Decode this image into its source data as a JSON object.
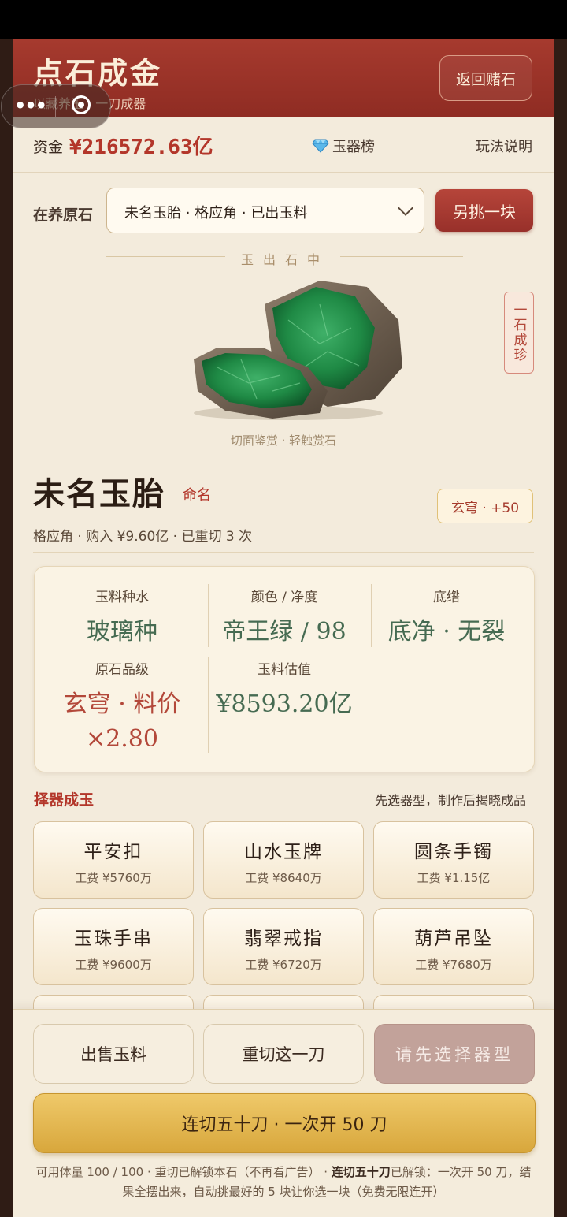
{
  "header": {
    "title": "点石成金",
    "subtitle": "以藏养玉 · 一刀成器",
    "back_label": "返回赌石"
  },
  "fund": {
    "label": "资金",
    "value": "¥216572.63亿",
    "rank_label": "玉器榜",
    "rank_icon": "diamond-icon",
    "rules_label": "玩法说明"
  },
  "stone_select": {
    "label": "在养原石",
    "selected": "未名玉胎 · 格应角 · 已出玉料",
    "pick_label": "另挑一块"
  },
  "viewer": {
    "section_title": "玉出石中",
    "side_tag": "一石成珍",
    "caption": "切面鉴赏 · 轻触赏石"
  },
  "stone": {
    "name": "未名玉胎",
    "rename_label": "命名",
    "grade_badge": "玄穹 · +50",
    "meta": "格应角 · 购入 ¥9.60亿 · 已重切 3 次"
  },
  "attributes": [
    {
      "label": "玉料种水",
      "value": "玻璃种"
    },
    {
      "label": "颜色 / 净度",
      "value": "帝王绿 / 98"
    },
    {
      "label": "底绺",
      "value": "底净 · 无裂"
    },
    {
      "label": "原石品级",
      "value": "玄穹 · 料价 ×2.80"
    },
    {
      "label": "玉料估值",
      "value": "¥8593.20亿"
    }
  ],
  "craft": {
    "title": "择器成玉",
    "hint": "先选器型，制作后揭晓成品",
    "items": [
      {
        "name": "平安扣",
        "fee": "工费 ¥5760万"
      },
      {
        "name": "山水玉牌",
        "fee": "工费 ¥8640万"
      },
      {
        "name": "圆条手镯",
        "fee": "工费 ¥1.15亿"
      },
      {
        "name": "玉珠手串",
        "fee": "工费 ¥9600万"
      },
      {
        "name": "翡翠戒指",
        "fee": "工费 ¥6720万"
      },
      {
        "name": "葫芦吊坠",
        "fee": "工费 ¥7680万"
      }
    ]
  },
  "actions": {
    "sell_label": "出售玉料",
    "recut_label": "重切这一刀",
    "make_label": "请先选择器型",
    "multi_cut_label": "连切五十刀 · 一次开 50 刀",
    "footnote_a": "可用体量 100 / 100 · 重切已解锁本石（不再看广告） · ",
    "footnote_b": "连切五十刀",
    "footnote_c": "已解锁：一次开 50 刀，结果全摆出来，自动挑最好的 5 块让你选一块（免费无限连开）"
  },
  "colors": {
    "brand_red": "#a63a2e",
    "gold": "#e3b54f",
    "jade_green": "#466b52"
  }
}
